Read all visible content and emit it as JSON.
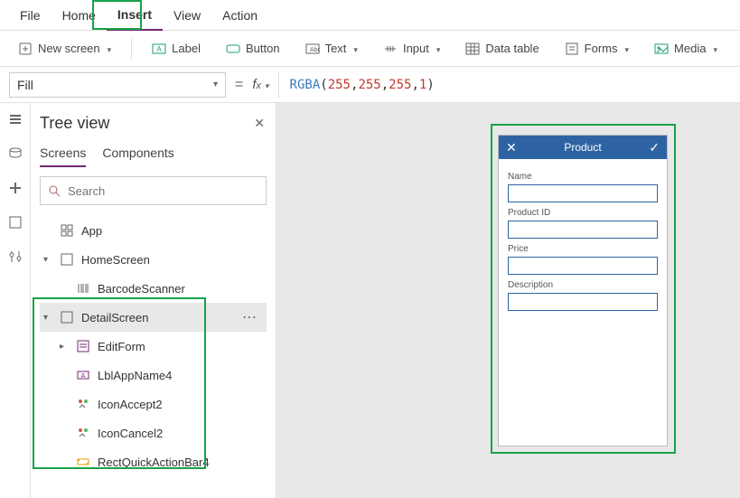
{
  "menubar": [
    "File",
    "Home",
    "Insert",
    "View",
    "Action"
  ],
  "menubar_active": 2,
  "ribbon": {
    "newscreen": "New screen",
    "label": "Label",
    "button": "Button",
    "text": "Text",
    "input": "Input",
    "datatable": "Data table",
    "forms": "Forms",
    "media": "Media"
  },
  "formula": {
    "property": "Fill",
    "fn": "RGBA",
    "args": [
      "255",
      "255",
      "255",
      "1"
    ]
  },
  "tree": {
    "title": "Tree view",
    "tabs": [
      "Screens",
      "Components"
    ],
    "tabs_active": 0,
    "search_placeholder": "Search",
    "app": "App",
    "nodes": {
      "home": "HomeScreen",
      "barcode": "BarcodeScanner",
      "detail": "DetailScreen",
      "editform": "EditForm",
      "lbl": "LblAppName4",
      "accept": "IconAccept2",
      "cancel": "IconCancel2",
      "rect": "RectQuickActionBar4"
    }
  },
  "phone": {
    "title": "Product",
    "fields": [
      "Name",
      "Product ID",
      "Price",
      "Description"
    ]
  }
}
